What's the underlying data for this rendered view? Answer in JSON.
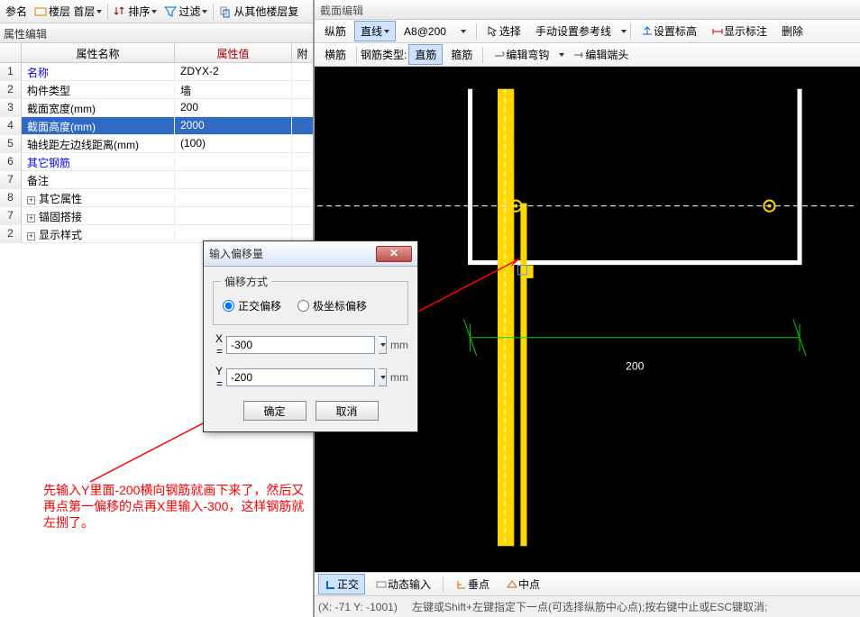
{
  "toolbar": {
    "rename": "参名",
    "floor": "楼层 首层",
    "sort": "排序",
    "filter": "过滤",
    "copy_from": "从其他楼层复"
  },
  "panel_title": "属性编辑",
  "grid": {
    "header_name": "属性名称",
    "header_value": "属性值",
    "header_extra": "附",
    "rows": [
      {
        "num": "1",
        "name": "名称",
        "val": "ZDYX-2",
        "blue": true
      },
      {
        "num": "2",
        "name": "构件类型",
        "val": "墙"
      },
      {
        "num": "3",
        "name": "截面宽度(mm)",
        "val": "200"
      },
      {
        "num": "4",
        "name": "截面高度(mm)",
        "val": "2000",
        "sel": true
      },
      {
        "num": "5",
        "name": "轴线距左边线距离(mm)",
        "val": "(100)"
      },
      {
        "num": "6",
        "name": "其它钢筋",
        "val": "",
        "blue": true
      },
      {
        "num": "7",
        "name": "备注",
        "val": ""
      },
      {
        "num": "8",
        "name": "其它属性",
        "val": "",
        "exp": true
      },
      {
        "num": "7",
        "name": "锚固搭接",
        "val": "",
        "exp": true
      },
      {
        "num": "2",
        "name": "显示样式",
        "val": "",
        "exp": true
      }
    ]
  },
  "right": {
    "title": "截面编辑",
    "tb1": {
      "zong": "纵筋",
      "zhi": "直线",
      "gang": "A8@200",
      "sel_arrow": "选择",
      "manual": "手动设置参考线",
      "elev": "设置标高",
      "show": "显示标注",
      "del": "删除"
    },
    "tb2": {
      "heng": "横筋",
      "type_lbl": "钢筋类型:",
      "zhi": "直筋",
      "gu": "箍筋",
      "hook": "编辑弯钩",
      "end": "编辑端头"
    },
    "bottom": {
      "ortho": "正交",
      "dyn": "动态输入",
      "perp": "垂点",
      "mid": "中点"
    },
    "status_coord": "(X: -71 Y: -1001)",
    "status_hint": "左键或Shift+左键指定下一点(可选择纵筋中心点);按右键中止或ESC键取消;",
    "dim_200": "200"
  },
  "dialog": {
    "title": "输入偏移量",
    "fs": "偏移方式",
    "r1": "正交偏移",
    "r2": "极坐标偏移",
    "x_lbl": "X =",
    "x_val": "-300",
    "y_lbl": "Y =",
    "y_val": "-200",
    "unit": "mm",
    "ok": "确定",
    "cancel": "取消"
  },
  "annotation": "先输入Y里面-200横向钢筋就画下来了，然后又再点第一偏移的点再X里输入-300，这样钢筋就左捌了。"
}
